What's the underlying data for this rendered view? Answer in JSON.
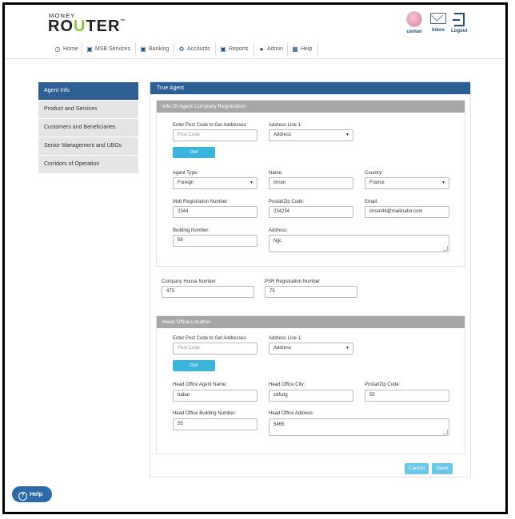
{
  "header": {
    "logo_top": "MONEY",
    "logo_bottom_a": "RO",
    "logo_bottom_u": "U",
    "logo_bottom_b": "TER",
    "logo_tm": "™",
    "user_label": "usman",
    "inbox_label": "Inbox",
    "logout_label": "Logout"
  },
  "nav": {
    "items": [
      {
        "label": "Home",
        "icon": "clock-icon"
      },
      {
        "label": "MSB Services",
        "icon": "document-icon"
      },
      {
        "label": "Banking",
        "icon": "document-icon"
      },
      {
        "label": "Accounts",
        "icon": "gear-icon"
      },
      {
        "label": "Reports",
        "icon": "document-icon"
      },
      {
        "label": "Admin",
        "icon": "user-icon"
      },
      {
        "label": "Help",
        "icon": "grid-icon"
      }
    ]
  },
  "sidebar": {
    "items": [
      {
        "label": "Agent Info",
        "active": true
      },
      {
        "label": "Product and Services"
      },
      {
        "label": "Customers and Beneficiaries"
      },
      {
        "label": "Senior Management and UBOs"
      },
      {
        "label": "Corridors of Operation"
      }
    ]
  },
  "main": {
    "title": "True Agent",
    "registration": {
      "heading": "Info Of Agent Company Registration",
      "postcode_label": "Enter Post Code to Get Addresses",
      "postcode_placeholder": "Post Code",
      "address_line_label": "Address Line 1:",
      "address_line_value": "Address",
      "get_label": "Get",
      "agent_type_label": "Agent Type:",
      "agent_type_value": "Foreign",
      "name_label": "Name:",
      "name_value": "imran",
      "country_label": "Country:",
      "country_value": "France",
      "msb_label": "Msb Registration Number:",
      "msb_value": "2344",
      "postal_label": "Postal/Zip Code:",
      "postal_value": "234234",
      "email_label": "Email:",
      "email_value": "imran44@mailinator.com",
      "building_label": "Building Number:",
      "building_value": "58",
      "address_label": "Address:",
      "address_value": "Njjc"
    },
    "company_house_label": "Company House Number",
    "company_house_value": "475",
    "psr_label": "PSR Registration Number",
    "psr_value": "75",
    "head_office": {
      "heading": "Head Office Location",
      "postcode_label": "Enter Post Code to Get Addresses",
      "postcode_placeholder": "Post Code",
      "address_line_label": "Address Line 1:",
      "address_line_value": "Address",
      "get_label": "Get",
      "agent_name_label": "Head Office Agent Name:",
      "agent_name_value": "babar",
      "city_label": "Head Office City:",
      "city_value": "zdfsdg",
      "postal_label": "Postal/Zip Code:",
      "postal_value": "55",
      "building_label": "Head Office Building Number:",
      "building_value": "55",
      "address_label": "Head Office Address:",
      "address_value": "5465"
    },
    "cancel_label": "Cancel",
    "save_label": "Save"
  },
  "help_button": "Help",
  "colors": {
    "primary": "#2e5f94",
    "accent": "#3ab4dd",
    "logo_green": "#8cc63f"
  }
}
